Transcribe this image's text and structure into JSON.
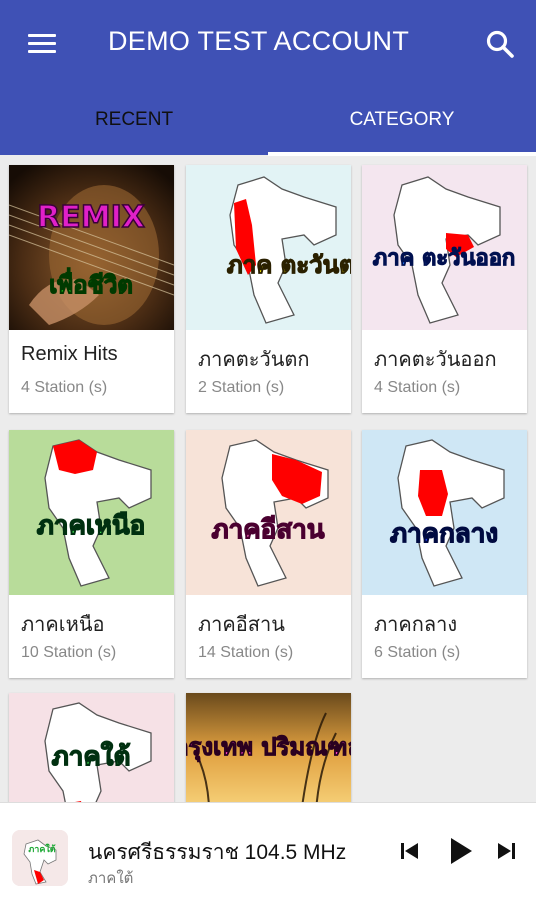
{
  "header": {
    "title": "DEMO TEST ACCOUNT",
    "menu_icon": "hamburger-menu-icon",
    "search_icon": "search-icon"
  },
  "tabs": [
    {
      "label": "RECENT",
      "selected": false
    },
    {
      "label": "CATEGORY",
      "selected": true
    }
  ],
  "categories": [
    {
      "name": "Remix Hits",
      "count": "4 Station (s)",
      "art_text_top": "REMIX",
      "art_text_bottom": "เพื่อชีวิต"
    },
    {
      "name": "ภาคตะวันตก",
      "count": "2 Station (s)",
      "art_text": "ภาค ตะวันตก"
    },
    {
      "name": "ภาคตะวันออก",
      "count": "4 Station (s)",
      "art_text": "ภาค ตะวันออก"
    },
    {
      "name": "ภาคเหนือ",
      "count": "10 Station (s)",
      "art_text": "ภาคเหนือ"
    },
    {
      "name": "ภาคอีสาน",
      "count": "14 Station (s)",
      "art_text": "ภาคอีสาน"
    },
    {
      "name": "ภาคกลาง",
      "count": "6 Station (s)",
      "art_text": "ภาคกลาง"
    },
    {
      "name": "",
      "count": "",
      "art_text": "ภาคใต้"
    },
    {
      "name": "",
      "count": "",
      "art_text": "กรุงเทพ ปริมณฑล"
    }
  ],
  "player": {
    "title": "นครศรีธรรมราช 104.5 MHz",
    "subtitle": "ภาคใต้",
    "logo_text": "ภาคใต้"
  },
  "colors": {
    "primary": "#3f51b5",
    "highlight_region": "#ff0000"
  }
}
